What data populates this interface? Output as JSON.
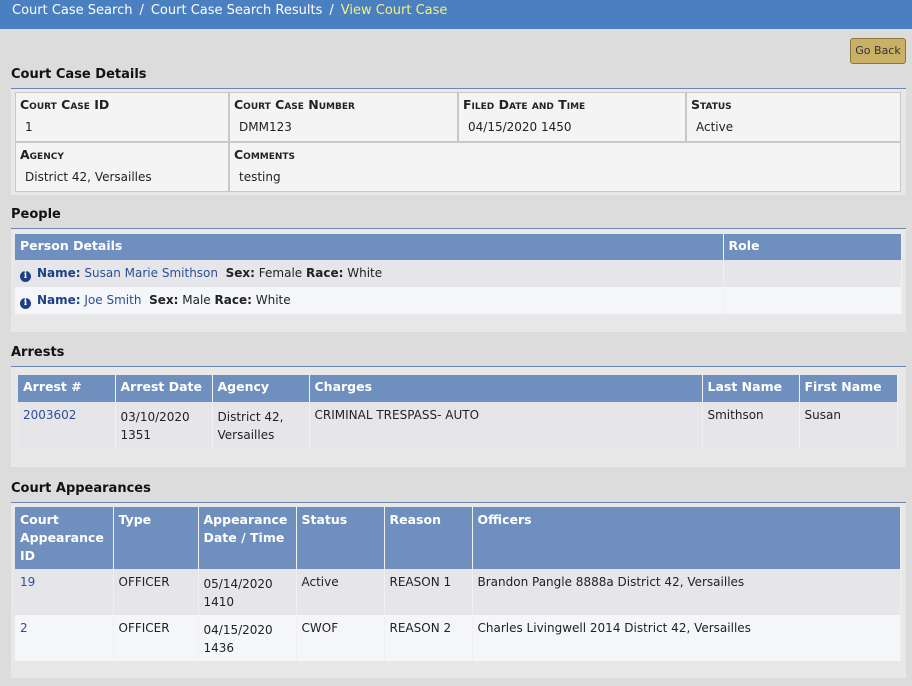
{
  "breadcrumb": {
    "items": [
      "Court Case Search",
      "Court Case Search Results"
    ],
    "current": "View Court Case",
    "separator": "/"
  },
  "go_back_label": "Go Back",
  "details": {
    "title": "Court Case Details",
    "case_id_label": "Court Case ID",
    "case_id": "1",
    "case_number_label": "Court Case Number",
    "case_number": "DMM123",
    "filed_label": "Filed Date and Time",
    "filed": "04/15/2020 1450",
    "status_label": "Status",
    "status": "Active",
    "agency_label": "Agency",
    "agency": "District 42, Versailles",
    "comments_label": "Comments",
    "comments": "testing"
  },
  "people": {
    "title": "People",
    "headers": [
      "Person Details",
      "Role"
    ],
    "name_label": "Name:",
    "sex_label": "Sex:",
    "race_label": "Race:",
    "rows": [
      {
        "name": "Susan Marie Smithson",
        "sex": "Female",
        "race": "White",
        "role": ""
      },
      {
        "name": "Joe Smith",
        "sex": "Male",
        "race": "White",
        "role": ""
      }
    ]
  },
  "arrests": {
    "title": "Arrests",
    "headers": [
      "Arrest #",
      "Arrest Date",
      "Agency",
      "Charges",
      "Last Name",
      "First Name"
    ],
    "rows": [
      {
        "arrest_no": "2003602",
        "date": "03/10/2020 1351",
        "agency": "District 42, Versailles",
        "charges": "CRIMINAL TRESPASS- AUTO",
        "last": "Smithson",
        "first": "Susan"
      }
    ]
  },
  "appearances": {
    "title": "Court Appearances",
    "headers": [
      "Court Appearance ID",
      "Type",
      "Appearance Date / Time",
      "Status",
      "Reason",
      "Officers"
    ],
    "rows": [
      {
        "id": "19",
        "type": "OFFICER",
        "datetime": "05/14/2020 1410",
        "status": "Active",
        "reason": "REASON 1",
        "officers": "Brandon Pangle 8888a District 42, Versailles"
      },
      {
        "id": "2",
        "type": "OFFICER",
        "datetime": "04/15/2020 1436",
        "status": "CWOF",
        "reason": "REASON 2",
        "officers": "Charles Livingwell 2014 District 42, Versailles"
      }
    ]
  },
  "colors": {
    "topbar": "#4a7fc1",
    "breadcrumb_current": "#f5f07a",
    "table_header": "#6f8fbf",
    "link": "#2a4f9a",
    "go_back": "#c9b066"
  },
  "icons": {
    "person_info": "info-icon"
  }
}
